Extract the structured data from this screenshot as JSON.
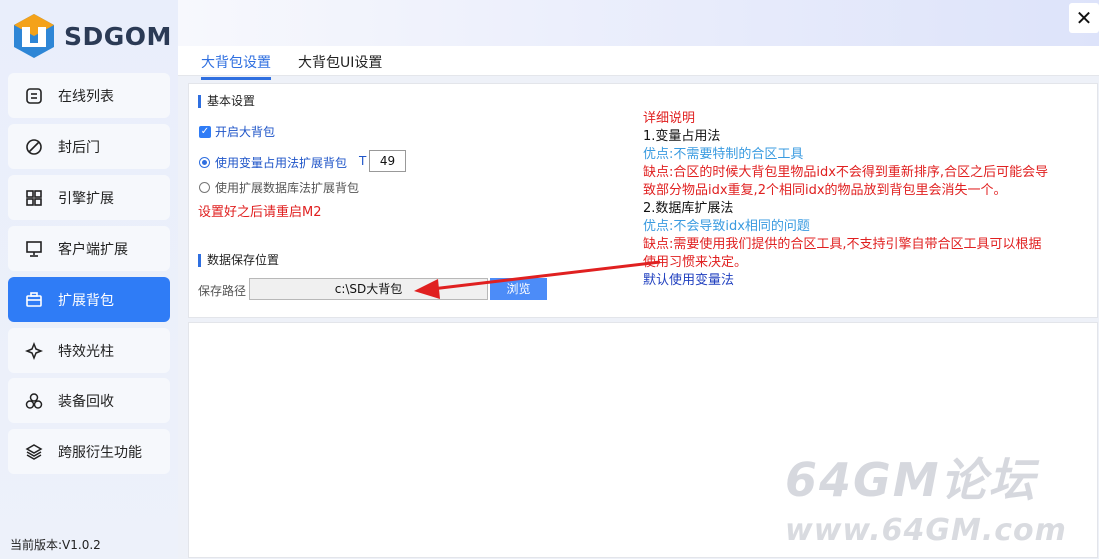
{
  "app": {
    "logo_text": "SDGOM",
    "version": "当前版本:V1.0.2",
    "close_glyph": "✕"
  },
  "sidebar": {
    "items": [
      {
        "label": "在线列表",
        "icon": "list-icon"
      },
      {
        "label": "封后门",
        "icon": "ban-icon"
      },
      {
        "label": "引擎扩展",
        "icon": "grid-icon"
      },
      {
        "label": "客户端扩展",
        "icon": "monitor-icon"
      },
      {
        "label": "扩展背包",
        "icon": "bag-icon",
        "active": true
      },
      {
        "label": "特效光柱",
        "icon": "sparkle-icon"
      },
      {
        "label": "装备回收",
        "icon": "recycle-icon"
      },
      {
        "label": "跨服衍生功能",
        "icon": "layers-icon"
      }
    ]
  },
  "tabs": [
    {
      "label": "大背包设置",
      "active": true
    },
    {
      "label": "大背包UI设置",
      "active": false
    }
  ],
  "basic": {
    "title": "基本设置",
    "enable_label": "开启大背包",
    "radio_variable": "使用变量占用法扩展背包",
    "t_label": "T",
    "t_value": "49",
    "radio_database": "使用扩展数据库法扩展背包",
    "restart_note": "设置好之后请重启M2"
  },
  "save": {
    "title": "数据保存位置",
    "path_label": "保存路径",
    "path_value": "c:\\SD大背包",
    "browse_label": "浏览"
  },
  "description": {
    "heading": "详细说明",
    "m1_title": "1.变量占用法",
    "m1_pro": "优点:不需要特制的合区工具",
    "m1_con_a": "缺点:合区的时候大背包里物品idx不会得到重新排序,合区之后可能会导",
    "m1_con_b": "致部分物品idx重复,2个相同idx的物品放到背包里会消失一个。",
    "m2_title": "2.数据库扩展法",
    "m2_pro": "优点:不会导致idx相同的问题",
    "m2_con_a": "缺点:需要使用我们提供的合区工具,不支持引擎自带合区工具可以根据",
    "m2_con_b": "使用习惯来决定。",
    "default_note": "默认使用变量法"
  },
  "watermark": {
    "line1": "64GM论坛",
    "line2": "www.64GM.com"
  },
  "colors": {
    "accent": "#2f7cf6",
    "note_red": "#e02020",
    "pro_blue": "#3a9be0"
  }
}
